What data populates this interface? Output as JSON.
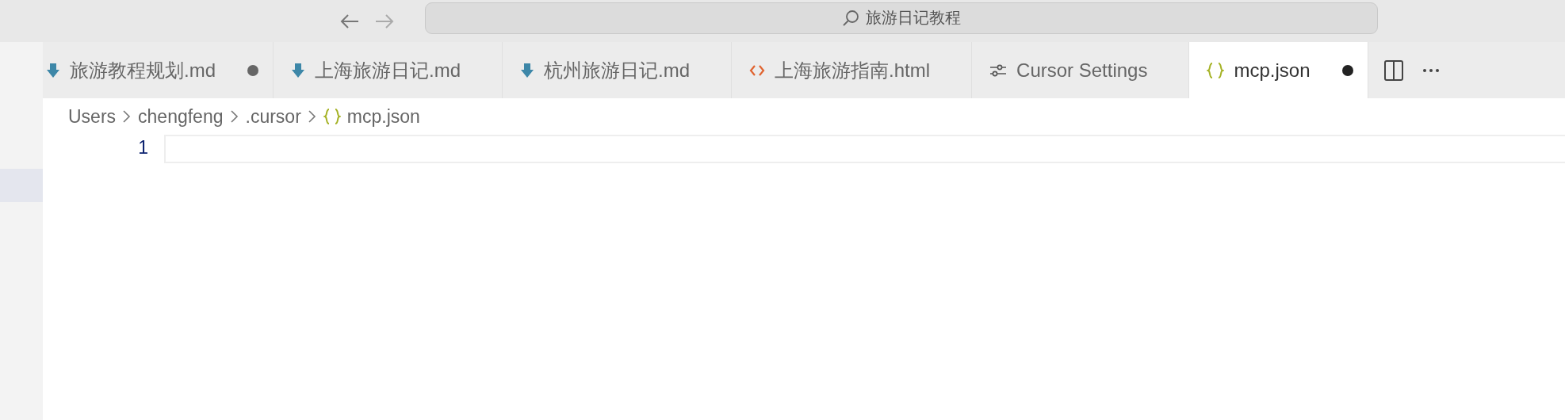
{
  "title_bar": {
    "command_center": "旅游日记教程"
  },
  "tabs": [
    {
      "label": "旅游教程规划.md",
      "kind": "markdown",
      "dirty": true,
      "selected": false
    },
    {
      "label": "上海旅游日记.md",
      "kind": "markdown",
      "dirty": false,
      "selected": false
    },
    {
      "label": "杭州旅游日记.md",
      "kind": "markdown",
      "dirty": false,
      "selected": false
    },
    {
      "label": "上海旅游指南.html",
      "kind": "html",
      "dirty": false,
      "selected": false
    },
    {
      "label": "Cursor Settings",
      "kind": "settings",
      "dirty": false,
      "selected": false
    },
    {
      "label": "mcp.json",
      "kind": "json",
      "dirty": true,
      "selected": true
    }
  ],
  "breadcrumb": [
    {
      "label": "Users",
      "kind": "folder"
    },
    {
      "label": "chengfeng",
      "kind": "folder"
    },
    {
      "label": ".cursor",
      "kind": "folder"
    },
    {
      "label": "mcp.json",
      "kind": "json"
    }
  ],
  "editor": {
    "line_numbers": [
      "1"
    ]
  }
}
